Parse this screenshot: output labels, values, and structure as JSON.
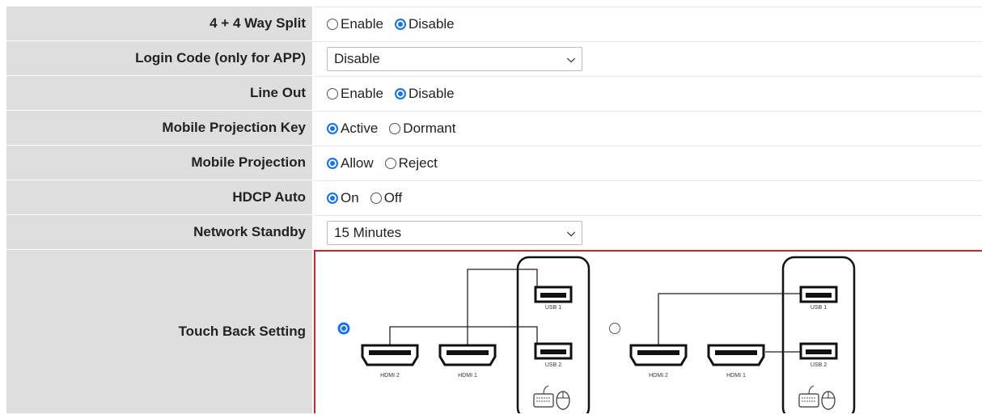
{
  "rows": {
    "split": {
      "label": "4 + 4 Way Split",
      "options": [
        "Enable",
        "Disable"
      ],
      "selected": "Disable"
    },
    "login": {
      "label": "Login Code (only for APP)",
      "value": "Disable"
    },
    "lineout": {
      "label": "Line Out",
      "options": [
        "Enable",
        "Disable"
      ],
      "selected": "Disable"
    },
    "mpkey": {
      "label": "Mobile Projection Key",
      "options": [
        "Active",
        "Dormant"
      ],
      "selected": "Active"
    },
    "mproj": {
      "label": "Mobile Projection",
      "options": [
        "Allow",
        "Reject"
      ],
      "selected": "Allow"
    },
    "hdcp": {
      "label": "HDCP Auto",
      "options": [
        "On",
        "Off"
      ],
      "selected": "On"
    },
    "standby": {
      "label": "Network Standby",
      "value": "15 Minutes"
    },
    "touch": {
      "label": "Touch Back Setting",
      "selected": "option1",
      "diagram": {
        "hdmi2": "HDMI 2",
        "hdmi1": "HDMI 1",
        "usb1": "USB 1",
        "usb2": "USB 2"
      }
    }
  },
  "colors": {
    "accent": "#1a73e8",
    "label_bg": "#dedede",
    "highlight_border": "#c0282d"
  },
  "icons": [
    "chevron-down-icon",
    "hdmi-port-icon",
    "usb-port-icon",
    "keyboard-icon",
    "mouse-icon"
  ]
}
